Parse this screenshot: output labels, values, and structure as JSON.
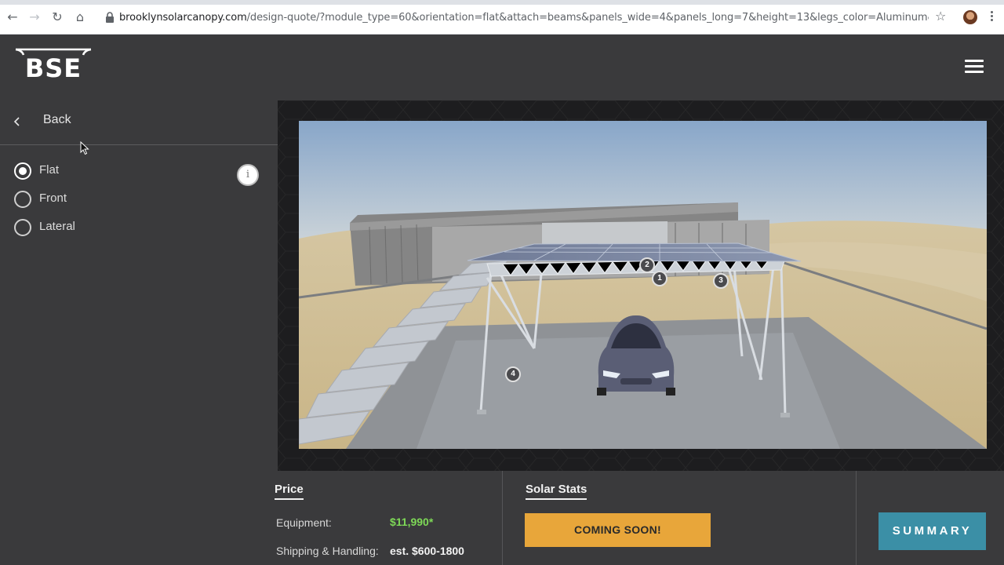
{
  "browser": {
    "url_host": "brooklynsolarcanopy.com",
    "url_path": "/design-quote/?module_type=60&orientation=flat&attach=beams&panels_wide=4&panels_long=7&height=13&legs_color=Aluminum&truss_color=..."
  },
  "header": {
    "logo_text": "BSE"
  },
  "sidebar": {
    "back_label": "Back",
    "options": [
      {
        "label": "Flat",
        "selected": true
      },
      {
        "label": "Front",
        "selected": false
      },
      {
        "label": "Lateral",
        "selected": false
      }
    ],
    "info_glyph": "i"
  },
  "viewer": {
    "markers": [
      "2",
      "1",
      "3",
      "4"
    ]
  },
  "price": {
    "title": "Price",
    "equipment_label": "Equipment:",
    "equipment_value": "$11,990*",
    "shipping_label": "Shipping & Handling:",
    "shipping_value": "est. $600-1800"
  },
  "solar_stats": {
    "title": "Solar Stats",
    "coming_soon": "COMING SOON!"
  },
  "summary_button": "SUMMARY",
  "colors": {
    "bg": "#3a3a3c",
    "accent_orange": "#e8a63a",
    "accent_teal": "#3b8fa6",
    "price_green": "#7ed957"
  }
}
